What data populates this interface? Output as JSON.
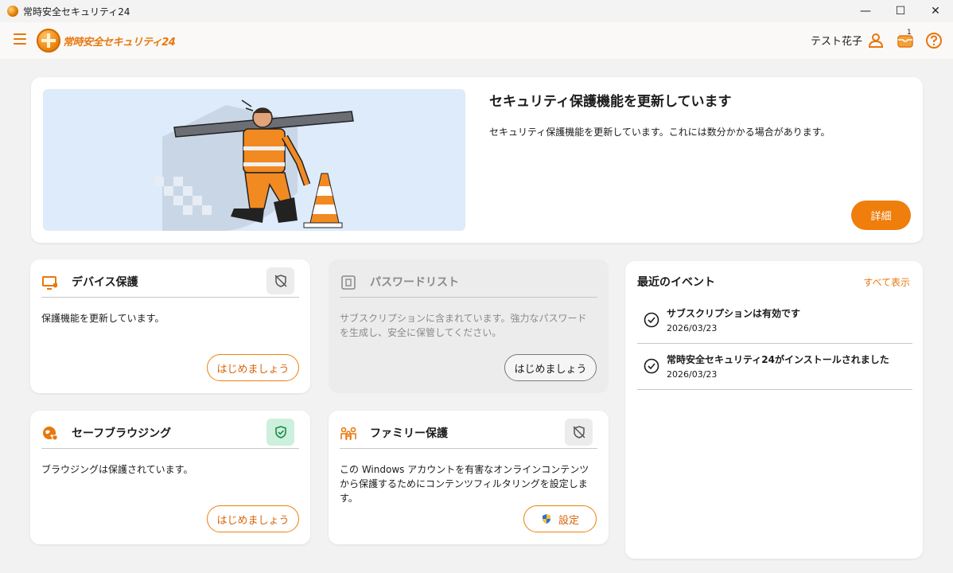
{
  "window": {
    "title": "常時安全セキュリティ24",
    "controls": {
      "minimize": "—",
      "maximize": "☐",
      "close": "✕"
    }
  },
  "header": {
    "logo_text": "常時安全セキュリティ24",
    "user_name": "テスト花子",
    "notification_count": "1",
    "icons": [
      "menu-icon",
      "user-icon",
      "notification-icon",
      "help-icon"
    ]
  },
  "hero": {
    "title": "セキュリティ保護機能を更新しています",
    "description": "セキュリティ保護機能を更新しています。これには数分かかる場合があります。",
    "button_label": "詳細"
  },
  "tiles": {
    "device": {
      "title": "デバイス保護",
      "text": "保護機能を更新しています。",
      "button_label": "はじめましょう",
      "status": "inactive"
    },
    "password": {
      "title": "パスワードリスト",
      "text": "サブスクリプションに含まれています。強力なパスワードを生成し、安全に保管してください。",
      "button_label": "はじめましょう",
      "status": "disabled"
    },
    "browsing": {
      "title": "セーフブラウジング",
      "text": "ブラウジングは保護されています。",
      "button_label": "はじめましょう",
      "status": "protected"
    },
    "family": {
      "title": "ファミリー保護",
      "text": "この Windows アカウントを有害なオンラインコンテンツから保護するためにコンテンツフィルタリングを設定します。",
      "button_label": "設定",
      "status": "inactive"
    }
  },
  "events": {
    "title": "最近のイベント",
    "show_all": "すべて表示",
    "items": [
      {
        "title": "サブスクリプションは有効です",
        "date": "2026/03/23"
      },
      {
        "title": "常時安全セキュリティ24がインストールされました",
        "date": "2026/03/23"
      }
    ]
  },
  "colors": {
    "accent": "#ef7e0c",
    "background": "#f3f2f2",
    "ok_status": "#cdf0dc",
    "hero_background": "#ddebfb"
  }
}
